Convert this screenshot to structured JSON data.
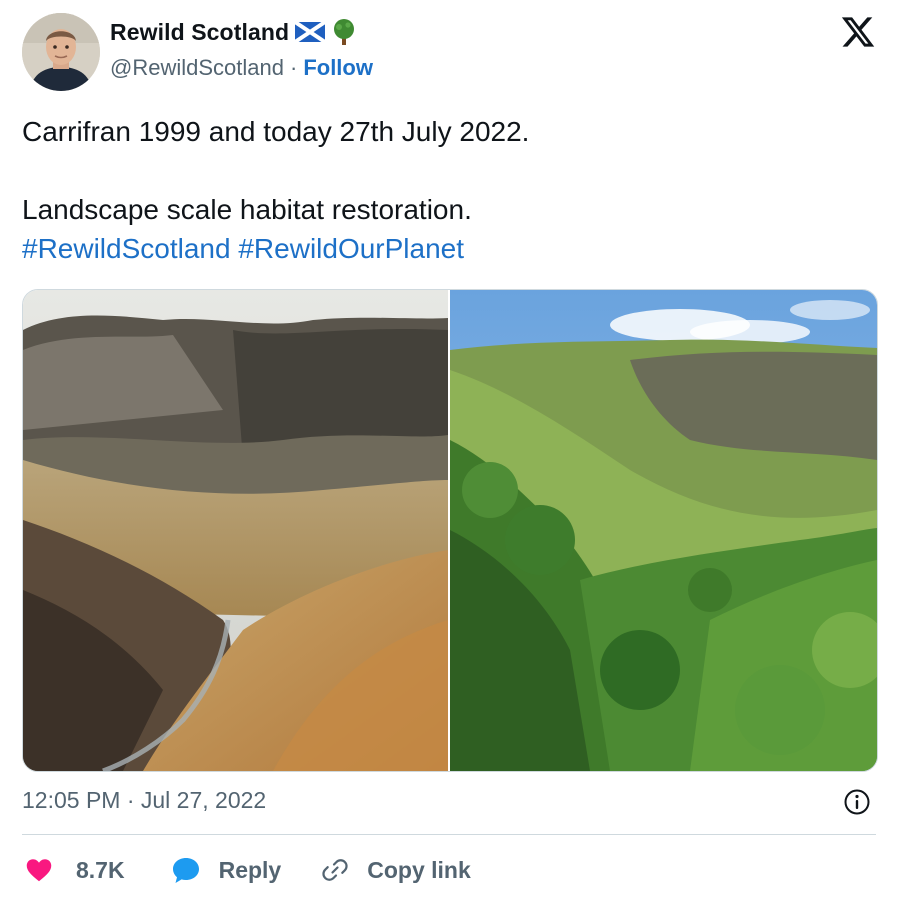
{
  "author": {
    "display_name": "Rewild Scotland",
    "handle": "@RewildScotland",
    "separator": "·",
    "follow_label": "Follow",
    "badges": [
      "scotland-flag-icon",
      "deciduous-tree-icon"
    ]
  },
  "tweet": {
    "line1": "Carrifran 1999 and today 27th July 2022.",
    "line2": "Landscape scale habitat restoration.",
    "hashtags": [
      "#RewildScotland",
      "#RewildOurPlanet"
    ]
  },
  "media": {
    "left_photo": "barren-valley-photo",
    "right_photo": "restored-woodland-valley-photo"
  },
  "meta": {
    "timestamp": "12:05 PM · Jul 27, 2022"
  },
  "actions": {
    "likes": "8.7K",
    "reply_label": "Reply",
    "copy_link_label": "Copy link"
  },
  "colors": {
    "link": "#1d70c7",
    "heart": "#f91880",
    "reply_bubble": "#1d9bf0",
    "secondary_text": "#536471",
    "divider": "#cfd9de"
  }
}
